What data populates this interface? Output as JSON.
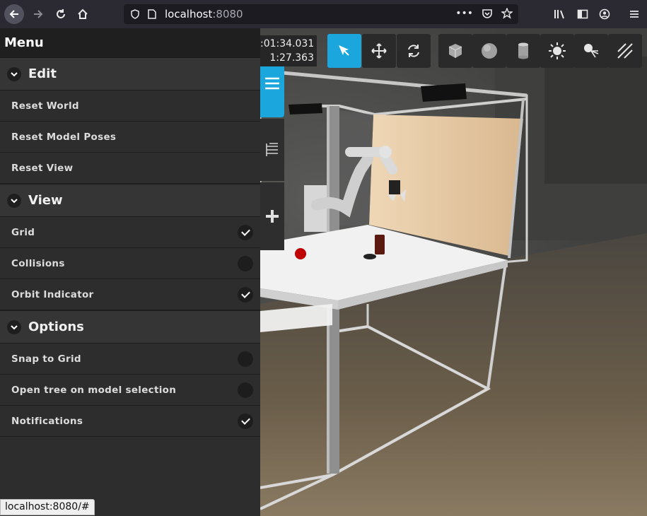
{
  "browser": {
    "url_host": "localhost",
    "url_port": ":8080",
    "status_url": "localhost:8080/#"
  },
  "menu": {
    "title": "Menu",
    "sections": [
      {
        "label": "Edit",
        "items": [
          {
            "label": "Reset World"
          },
          {
            "label": "Reset Model Poses"
          },
          {
            "label": "Reset View"
          }
        ]
      },
      {
        "label": "View",
        "items": [
          {
            "label": "Grid",
            "checked": true
          },
          {
            "label": "Collisions",
            "checked": false
          },
          {
            "label": "Orbit Indicator",
            "checked": true
          }
        ]
      },
      {
        "label": "Options",
        "items": [
          {
            "label": "Snap to Grid",
            "checked": false
          },
          {
            "label": "Open tree on model selection",
            "checked": false
          },
          {
            "label": "Notifications",
            "checked": true
          }
        ]
      }
    ]
  },
  "clock": {
    "sim_time": ":01:34.031",
    "real_time": "1:27.363"
  },
  "toolbar": {
    "tools": [
      "select-icon",
      "translate-icon",
      "rotate-icon",
      "box-icon",
      "sphere-icon",
      "cylinder-icon",
      "point-light-icon",
      "spot-light-icon",
      "directional-light-icon"
    ],
    "accent": "#1ba7dd"
  }
}
